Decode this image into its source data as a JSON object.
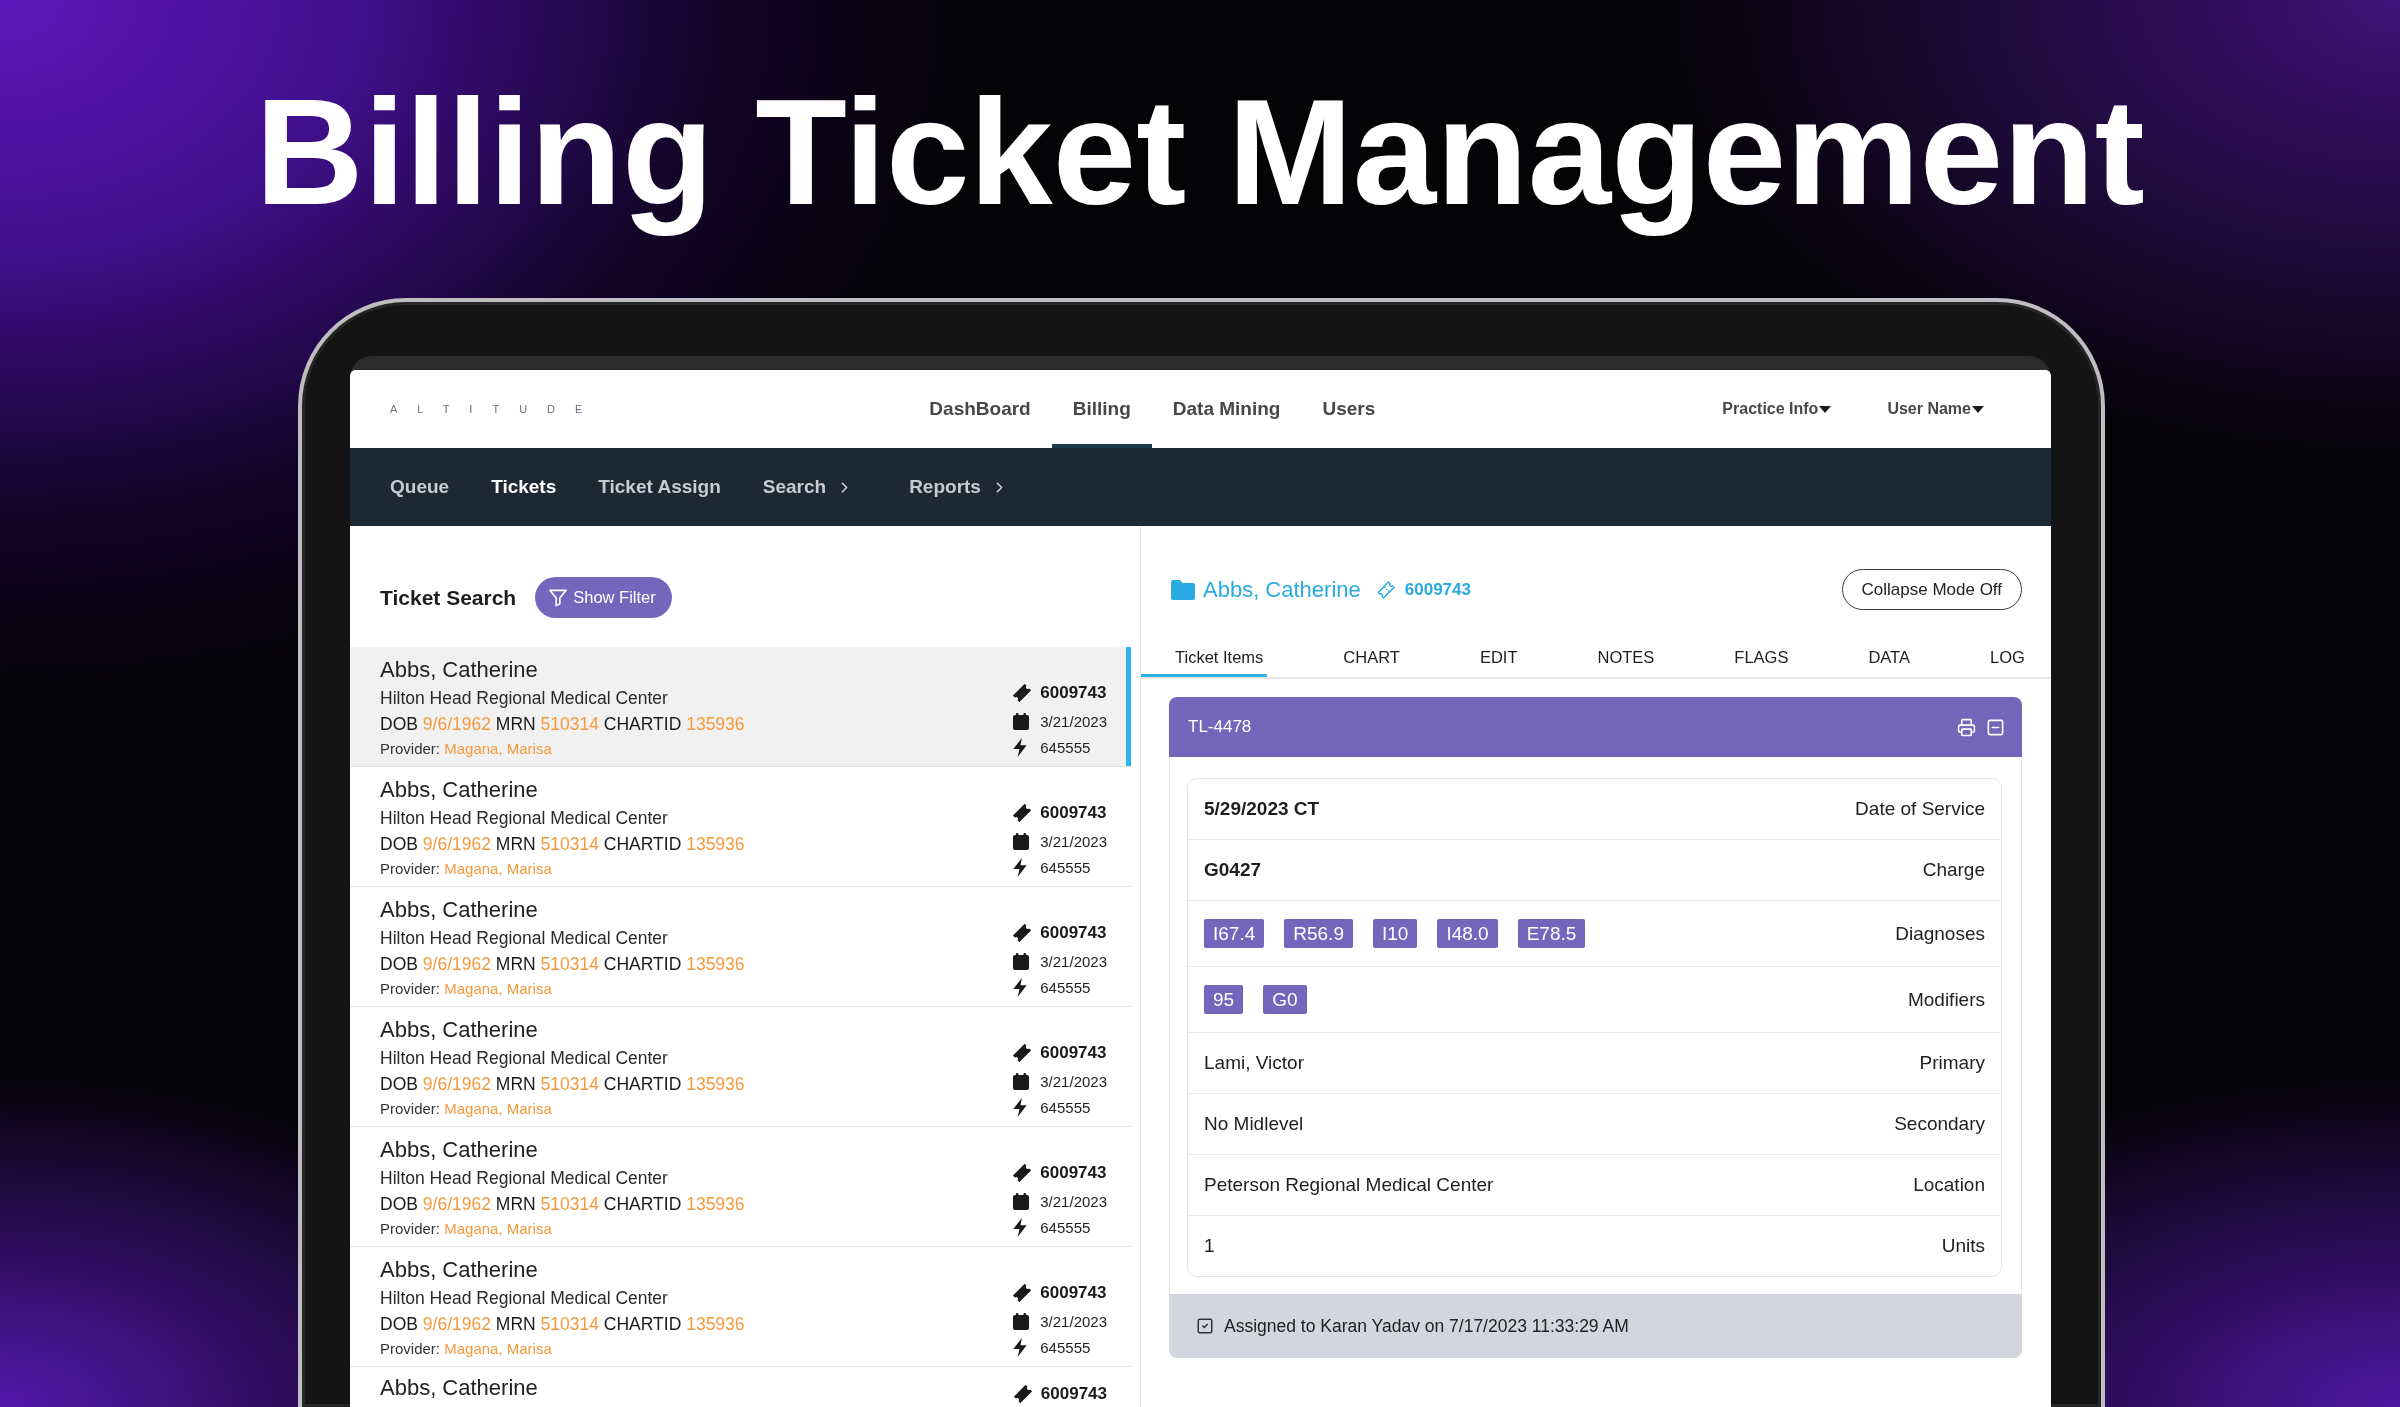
{
  "headline": "Billing Ticket Management",
  "header": {
    "logo": "ALTITUDE",
    "nav": [
      {
        "label": "DashBoard",
        "selected": false
      },
      {
        "label": "Billing",
        "selected": true
      },
      {
        "label": "Data Mining",
        "selected": false
      },
      {
        "label": "Users",
        "selected": false
      }
    ],
    "menus": [
      "Practice Info",
      "User Name"
    ]
  },
  "subnav": [
    {
      "label": "Queue",
      "selected": false,
      "submenu": false
    },
    {
      "label": "Tickets",
      "selected": true,
      "submenu": false
    },
    {
      "label": "Ticket Assign",
      "selected": false,
      "submenu": false
    },
    {
      "label": "Search",
      "selected": false,
      "submenu": true
    },
    {
      "label": "Reports",
      "selected": false,
      "submenu": true
    }
  ],
  "ticket_search": {
    "title": "Ticket Search",
    "filter_button": "Show Filter",
    "tickets": [
      {
        "name": "Abbs, Catherine",
        "facility": "Hilton Head Regional Medical Center",
        "ids": [
          {
            "label": "DOB",
            "value": "9/6/1962"
          },
          {
            "label": "MRN",
            "value": "510314"
          },
          {
            "label": "CHARTID",
            "value": "135936"
          }
        ],
        "provider_label": "Provider:",
        "provider": "Magana, Marisa",
        "ticket": "6009743",
        "date": "3/21/2023",
        "code": "645555",
        "selected": true
      },
      {
        "name": "Abbs, Catherine",
        "facility": "Hilton Head Regional Medical Center",
        "ids": [
          {
            "label": "DOB",
            "value": "9/6/1962"
          },
          {
            "label": "MRN",
            "value": "510314"
          },
          {
            "label": "CHARTID",
            "value": "135936"
          }
        ],
        "provider_label": "Provider:",
        "provider": "Magana, Marisa",
        "ticket": "6009743",
        "date": "3/21/2023",
        "code": "645555",
        "selected": false
      },
      {
        "name": "Abbs, Catherine",
        "facility": "Hilton Head Regional Medical Center",
        "ids": [
          {
            "label": "DOB",
            "value": "9/6/1962"
          },
          {
            "label": "MRN",
            "value": "510314"
          },
          {
            "label": "CHARTID",
            "value": "135936"
          }
        ],
        "provider_label": "Provider:",
        "provider": "Magana, Marisa",
        "ticket": "6009743",
        "date": "3/21/2023",
        "code": "645555",
        "selected": false
      },
      {
        "name": "Abbs, Catherine",
        "facility": "Hilton Head Regional Medical Center",
        "ids": [
          {
            "label": "DOB",
            "value": "9/6/1962"
          },
          {
            "label": "MRN",
            "value": "510314"
          },
          {
            "label": "CHARTID",
            "value": "135936"
          }
        ],
        "provider_label": "Provider:",
        "provider": "Magana, Marisa",
        "ticket": "6009743",
        "date": "3/21/2023",
        "code": "645555",
        "selected": false
      },
      {
        "name": "Abbs, Catherine",
        "facility": "Hilton Head Regional Medical Center",
        "ids": [
          {
            "label": "DOB",
            "value": "9/6/1962"
          },
          {
            "label": "MRN",
            "value": "510314"
          },
          {
            "label": "CHARTID",
            "value": "135936"
          }
        ],
        "provider_label": "Provider:",
        "provider": "Magana, Marisa",
        "ticket": "6009743",
        "date": "3/21/2023",
        "code": "645555",
        "selected": false
      },
      {
        "name": "Abbs, Catherine",
        "facility": "Hilton Head Regional Medical Center",
        "ids": [
          {
            "label": "DOB",
            "value": "9/6/1962"
          },
          {
            "label": "MRN",
            "value": "510314"
          },
          {
            "label": "CHARTID",
            "value": "135936"
          }
        ],
        "provider_label": "Provider:",
        "provider": "Magana, Marisa",
        "ticket": "6009743",
        "date": "3/21/2023",
        "code": "645555",
        "selected": false
      },
      {
        "name": "Abbs, Catherine",
        "ticket": "6009743",
        "selected": false
      }
    ]
  },
  "detail": {
    "patient": "Abbs, Catherine",
    "ticket": "6009743",
    "collapse_button": "Collapse Mode Off",
    "tabs": [
      {
        "label": "Ticket Items",
        "selected": true
      },
      {
        "label": "CHART",
        "selected": false
      },
      {
        "label": "EDIT",
        "selected": false
      },
      {
        "label": "NOTES",
        "selected": false
      },
      {
        "label": "FLAGS",
        "selected": false
      },
      {
        "label": "DATA",
        "selected": false
      },
      {
        "label": "LOG",
        "selected": false
      }
    ],
    "item": {
      "id": "TL-4478",
      "rows": [
        {
          "kind": "text",
          "value": "5/29/2023 CT",
          "bold": true,
          "label": "Date of Service"
        },
        {
          "kind": "text",
          "value": "G0427",
          "bold": true,
          "label": "Charge"
        },
        {
          "kind": "codes",
          "codes": [
            "I67.4",
            "R56.9",
            "I10",
            "I48.0",
            "E78.5"
          ],
          "label": "Diagnoses"
        },
        {
          "kind": "codes",
          "codes": [
            "95",
            "G0"
          ],
          "label": "Modifiers"
        },
        {
          "kind": "text",
          "value": "Lami, Victor",
          "bold": false,
          "label": "Primary"
        },
        {
          "kind": "text",
          "value": "No Midlevel",
          "bold": false,
          "label": "Secondary"
        },
        {
          "kind": "text",
          "value": "Peterson Regional Medical Center",
          "bold": false,
          "label": "Location"
        },
        {
          "kind": "text",
          "value": "1",
          "bold": false,
          "label": "Units"
        }
      ],
      "assigned": "Assigned to Karan Yadav on 7/17/2023 11:33:29 AM"
    }
  }
}
